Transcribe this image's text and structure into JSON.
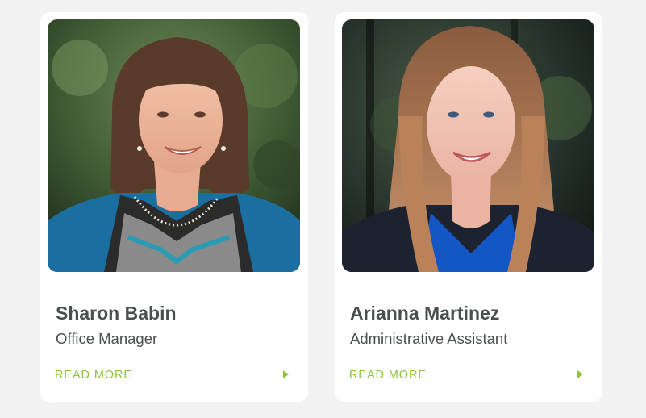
{
  "team": {
    "members": [
      {
        "name": "Sharon Babin",
        "role": "Office Manager",
        "cta_label": "READ MORE",
        "icon": "chevron-right-icon"
      },
      {
        "name": "Arianna Martinez",
        "role": "Administrative Assistant",
        "cta_label": "READ MORE",
        "icon": "chevron-right-icon"
      }
    ]
  },
  "colors": {
    "page_background": "#f2f2f2",
    "card_background": "#ffffff",
    "text": "#4a4f4f",
    "accent": "#8dc43f"
  }
}
